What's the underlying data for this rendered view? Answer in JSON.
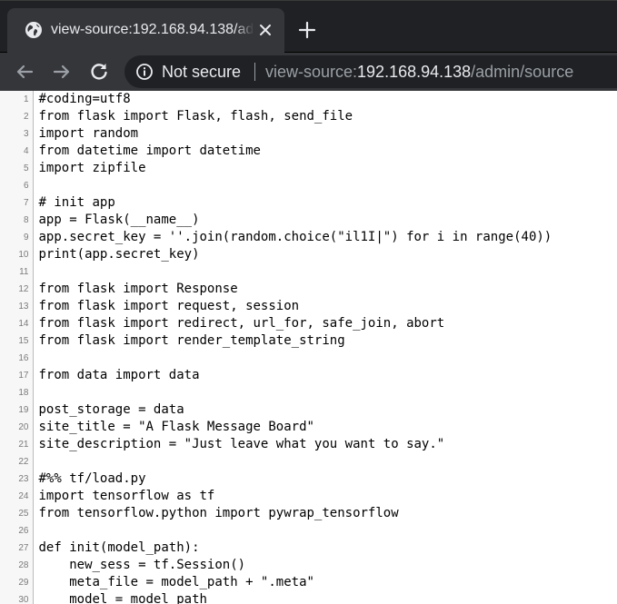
{
  "tab": {
    "title": "view-source:192.168.94.138/admin/source",
    "favicon": "globe-icon",
    "close": "close-icon"
  },
  "new_tab": "plus-icon",
  "toolbar": {
    "back": "arrow-left-icon",
    "forward": "arrow-right-icon",
    "reload": "reload-icon"
  },
  "omnibox": {
    "security_icon": "info-icon",
    "security_label": "Not secure",
    "url_scheme": "view-source:",
    "url_host": "192.168.94.138",
    "url_path": "/admin/source"
  },
  "colors": {
    "frame": "#202124",
    "toolbar": "#35363a",
    "text_light": "#e8eaed",
    "text_dim": "#9aa0a6",
    "line_number": "#7a7a7a"
  },
  "source_lines": [
    {
      "n": "1",
      "text": "#coding=utf8"
    },
    {
      "n": "2",
      "text": "from flask import Flask, flash, send_file"
    },
    {
      "n": "3",
      "text": "import random"
    },
    {
      "n": "4",
      "text": "from datetime import datetime"
    },
    {
      "n": "5",
      "text": "import zipfile"
    },
    {
      "n": "6",
      "text": ""
    },
    {
      "n": "7",
      "text": "# init app"
    },
    {
      "n": "8",
      "text": "app = Flask(__name__)"
    },
    {
      "n": "9",
      "text": "app.secret_key = ''.join(random.choice(\"il1I|\") for i in range(40))"
    },
    {
      "n": "10",
      "text": "print(app.secret_key)"
    },
    {
      "n": "11",
      "text": ""
    },
    {
      "n": "12",
      "text": "from flask import Response"
    },
    {
      "n": "13",
      "text": "from flask import request, session"
    },
    {
      "n": "14",
      "text": "from flask import redirect, url_for, safe_join, abort"
    },
    {
      "n": "15",
      "text": "from flask import render_template_string"
    },
    {
      "n": "16",
      "text": ""
    },
    {
      "n": "17",
      "text": "from data import data"
    },
    {
      "n": "18",
      "text": ""
    },
    {
      "n": "19",
      "text": "post_storage = data"
    },
    {
      "n": "20",
      "text": "site_title = \"A Flask Message Board\""
    },
    {
      "n": "21",
      "text": "site_description = \"Just leave what you want to say.\""
    },
    {
      "n": "22",
      "text": ""
    },
    {
      "n": "23",
      "text": "#%% tf/load.py"
    },
    {
      "n": "24",
      "text": "import tensorflow as tf"
    },
    {
      "n": "25",
      "text": "from tensorflow.python import pywrap_tensorflow"
    },
    {
      "n": "26",
      "text": ""
    },
    {
      "n": "27",
      "text": "def init(model_path):"
    },
    {
      "n": "28",
      "text": "    new_sess = tf.Session()"
    },
    {
      "n": "29",
      "text": "    meta_file = model_path + \".meta\""
    },
    {
      "n": "30",
      "text": "    model = model_path"
    }
  ]
}
